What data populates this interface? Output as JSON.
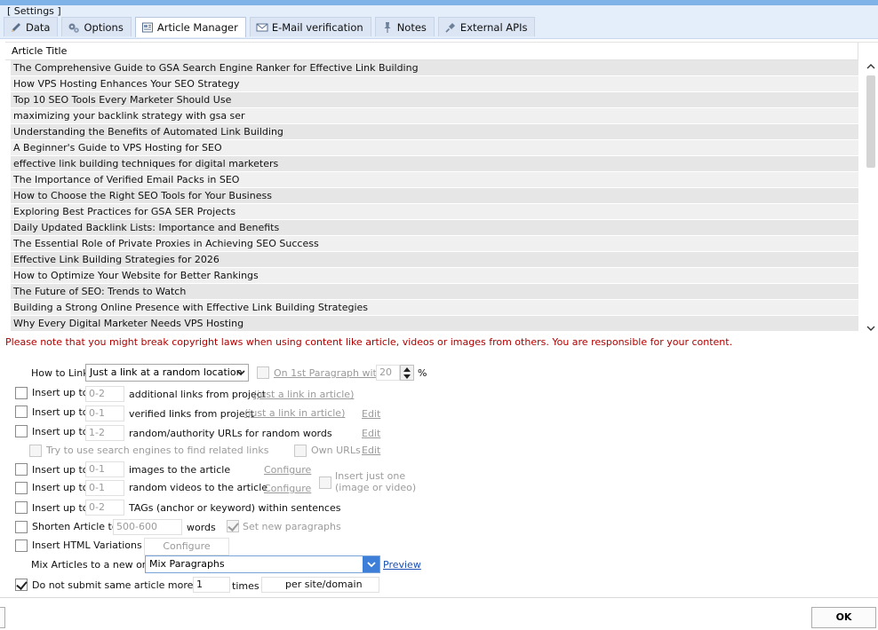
{
  "header": {
    "section_title": "[ Settings ]",
    "tabs": [
      {
        "label": "Data",
        "icon": "pencil-icon"
      },
      {
        "label": "Options",
        "icon": "gears-icon"
      },
      {
        "label": "Article Manager",
        "icon": "article-icon"
      },
      {
        "label": "E-Mail verification",
        "icon": "envelope-icon"
      },
      {
        "label": "Notes",
        "icon": "note-pin-icon"
      },
      {
        "label": "External APIs",
        "icon": "plug-icon"
      }
    ],
    "active_tab": "Article Manager"
  },
  "articles": {
    "column_header": "Article Title",
    "rows": [
      "The Comprehensive Guide to GSA Search Engine Ranker for Effective Link Building",
      "How VPS Hosting Enhances Your SEO Strategy",
      "Top 10 SEO Tools Every Marketer Should Use",
      "maximizing your backlink strategy with gsa ser",
      "Understanding the Benefits of Automated Link Building",
      "A Beginner's Guide to VPS Hosting for SEO",
      "effective link building techniques for digital marketers",
      "The Importance of Verified Email Packs in SEO",
      "How to Choose the Right SEO Tools for Your Business",
      "Exploring Best Practices for GSA SER Projects",
      "Daily Updated Backlink Lists: Importance and Benefits",
      "The Essential Role of Private Proxies in Achieving SEO Success",
      "Effective Link Building Strategies for 2026",
      "How to Optimize Your Website for Better Rankings",
      "The Future of SEO: Trends to Watch",
      "Building a Strong Online Presence with Effective Link Building Strategies",
      "Why Every Digital Marketer Needs VPS Hosting"
    ]
  },
  "warning": "Please note that you might break copyright laws when using content like article, videos or images from others. You are responsible for your content.",
  "options": {
    "how_to_link_label": "How to Link",
    "how_to_link_value": "Just a link at a random location",
    "first_paragraph_label": "On 1st Paragraph with",
    "first_paragraph_value": "20",
    "percent": "%",
    "insert_up_to": "Insert up to",
    "additional_links": {
      "value": "0-2",
      "label": "additional links from project",
      "link": "(just a link in article)"
    },
    "verified_links": {
      "value": "0-1",
      "label": "verified links from project",
      "link": "(just a link in article)",
      "edit": "Edit"
    },
    "random_urls": {
      "value": "1-2",
      "label": "random/authority URLs for random words",
      "edit": "Edit"
    },
    "search_engines": {
      "label": "Try to use search engines to find related links",
      "own_urls": "Own URLs",
      "edit": "Edit"
    },
    "images": {
      "value": "0-1",
      "label": "images to the article",
      "configure": "Configure"
    },
    "videos": {
      "value": "0-1",
      "label": "random videos to the article",
      "configure": "Configure"
    },
    "insert_just_one": "Insert just one (image or video)",
    "tags": {
      "value": "0-2",
      "label": "TAGs (anchor or keyword) within sentences"
    },
    "shorten": {
      "label": "Shorten Article to",
      "value": "500-600",
      "unit": "words",
      "new_paragraphs": "Set new paragraphs"
    },
    "html_variations": {
      "label": "Insert HTML Variations",
      "configure": "Configure"
    },
    "mix": {
      "label": "Mix Articles to a new one",
      "value": "Mix Paragraphs",
      "preview": "Preview"
    },
    "no_same_article": {
      "label": "Do not submit same article more than",
      "value": "1",
      "unit": "times",
      "scope": "per site/domain"
    }
  },
  "footer": {
    "ok_label": "OK"
  }
}
